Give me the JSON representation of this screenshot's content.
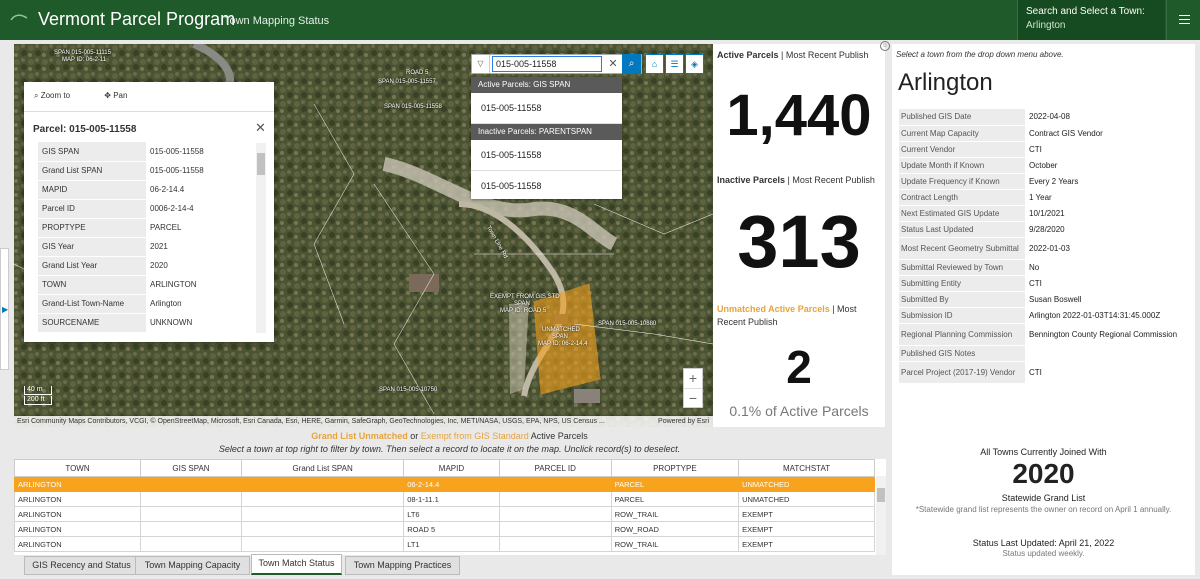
{
  "header": {
    "title": "Vermont Parcel Program",
    "subtitle": "Town Mapping Status",
    "town_select_label": "Search and Select a Town:",
    "town_select_value": "Arlington"
  },
  "map": {
    "popup": {
      "zoom_to": "Zoom to",
      "pan": "Pan",
      "title": "Parcel: 015-005-11558",
      "fields": [
        {
          "k": "GIS SPAN",
          "v": "015-005-11558"
        },
        {
          "k": "Grand List SPAN",
          "v": "015-005-11558"
        },
        {
          "k": "MAPID",
          "v": "06-2-14.4"
        },
        {
          "k": "Parcel ID",
          "v": "0006-2-14-4"
        },
        {
          "k": "PROPTYPE",
          "v": "PARCEL"
        },
        {
          "k": "GIS Year",
          "v": "2021"
        },
        {
          "k": "Grand List Year",
          "v": "2020"
        },
        {
          "k": "TOWN",
          "v": "ARLINGTON"
        },
        {
          "k": "Grand-List Town-Name",
          "v": "Arlington"
        },
        {
          "k": "SOURCENAME",
          "v": "UNKNOWN"
        }
      ]
    },
    "search": {
      "value": "015-005-11558",
      "groups": [
        {
          "header": "Active Parcels: GIS SPAN",
          "items": [
            "015-005-11558"
          ]
        },
        {
          "header": "Inactive Parcels: PARENTSPAN",
          "items": [
            "015-005-11558",
            "015-005-11558"
          ]
        }
      ]
    },
    "scale": {
      "m": "40 m",
      "ft": "200 ft"
    },
    "attribution": "Esri Community Maps Contributors, VCGI, © OpenStreetMap, Microsoft, Esri Canada, Esri, HERE, Garmin, SafeGraph, GeoTechnologies, Inc, METI/NASA, USGS, EPA, NPS, US Census ...",
    "powered_by": "Powered by Esri",
    "labels": {
      "l1": "SPAN 015-005-11115",
      "l2": "MAP ID: 06-2-11",
      "l3": "ROAD 5",
      "l4": "SPAN 015-005-11557",
      "l5": "SPAN 015-005-11558",
      "l6": "EXEMPT FROM GIS STD",
      "l7": "SPAN",
      "l8": "MAP ID: ROAD 5",
      "l9": "UNMATCHED",
      "l10": "SPAN",
      "l11": "MAP ID: 06-2-14.4",
      "l12": "Town Line Rd",
      "l13": "SPAN 015-005-10880",
      "l14": "SPAN 015-005-10750"
    }
  },
  "stats": {
    "active_label": "Active Parcels",
    "active_suffix": " | Most Recent Publish",
    "active_value": "1,440",
    "inactive_label": "Inactive Parcels",
    "inactive_suffix": " | Most Recent Publish",
    "inactive_value": "313",
    "unmatched_label": "Unmatched Active Parcels",
    "unmatched_suffix": " | Most Recent Publish",
    "unmatched_value": "2",
    "unmatched_pct": "0.1% of Active Parcels"
  },
  "info": {
    "hint": "Select a town from the drop down menu above.",
    "town": "Arlington",
    "rows": [
      {
        "k": "Published GIS Date",
        "v": "2022-04-08"
      },
      {
        "k": "Current Map Capacity",
        "v": "Contract GIS Vendor"
      },
      {
        "k": "Current Vendor",
        "v": "CTI"
      },
      {
        "k": "Update Month if Known",
        "v": "October"
      },
      {
        "k": "Update Frequency if Known",
        "v": "Every 2 Years"
      },
      {
        "k": "Contract Length",
        "v": "1 Year"
      },
      {
        "k": "Next Estimated GIS Update",
        "v": "10/1/2021"
      },
      {
        "k": "Status Last Updated",
        "v": "9/28/2020"
      },
      {
        "k": "Most Recent Geometry Submittal",
        "v": "2022-01-03"
      },
      {
        "k": "Submittal Reviewed by Town",
        "v": "No"
      },
      {
        "k": "Submitting Entity",
        "v": "CTI"
      },
      {
        "k": "Submitted By",
        "v": "Susan Boswell"
      },
      {
        "k": "Submission ID",
        "v": "Arlington 2022-01-03T14:31:45.000Z"
      },
      {
        "k": "Regional Planning Commission",
        "v": "Bennington County Regional Commission"
      },
      {
        "k": "Published GIS Notes",
        "v": ""
      },
      {
        "k": "Parcel Project (2017-19) Vendor",
        "v": "CTI"
      }
    ],
    "joined_title": "All Towns Currently Joined With",
    "joined_year": "2020",
    "joined_sub": "Statewide Grand List",
    "joined_note": "*Statewide grand list represents the owner on record on April 1 annually.",
    "status_updated": "Status Last Updated: April 21, 2022",
    "status_freq": "Status updated weekly."
  },
  "table": {
    "title_gl": "Grand List Unmatched",
    "title_or": " or ",
    "title_ex": "Exempt from GIS Standard",
    "title_rest": " Active Parcels",
    "subtitle": "Select a town at top right to filter by town. Then select a record to locate it on the map. Unclick record(s) to deselect.",
    "columns": [
      "TOWN",
      "GIS SPAN",
      "Grand List SPAN",
      "MAPID",
      "PARCEL ID",
      "PROPTYPE",
      "MATCHSTAT"
    ],
    "rows": [
      [
        "ARLINGTON",
        "",
        "",
        "06-2-14.4",
        "",
        "PARCEL",
        "UNMATCHED"
      ],
      [
        "ARLINGTON",
        "",
        "",
        "08-1-11.1",
        "",
        "PARCEL",
        "UNMATCHED"
      ],
      [
        "ARLINGTON",
        "",
        "",
        "LT6",
        "",
        "ROW_TRAIL",
        "EXEMPT"
      ],
      [
        "ARLINGTON",
        "",
        "",
        "ROAD 5",
        "",
        "ROW_ROAD",
        "EXEMPT"
      ],
      [
        "ARLINGTON",
        "",
        "",
        "LT1",
        "",
        "ROW_TRAIL",
        "EXEMPT"
      ]
    ]
  },
  "tabs": [
    "GIS Recency and Status",
    "Town Mapping Capacity",
    "Town Match Status",
    "Town Mapping Practices"
  ],
  "colors": {
    "header": "#1e5a2a",
    "accent": "#f7a31e",
    "link": "#0079c1"
  }
}
